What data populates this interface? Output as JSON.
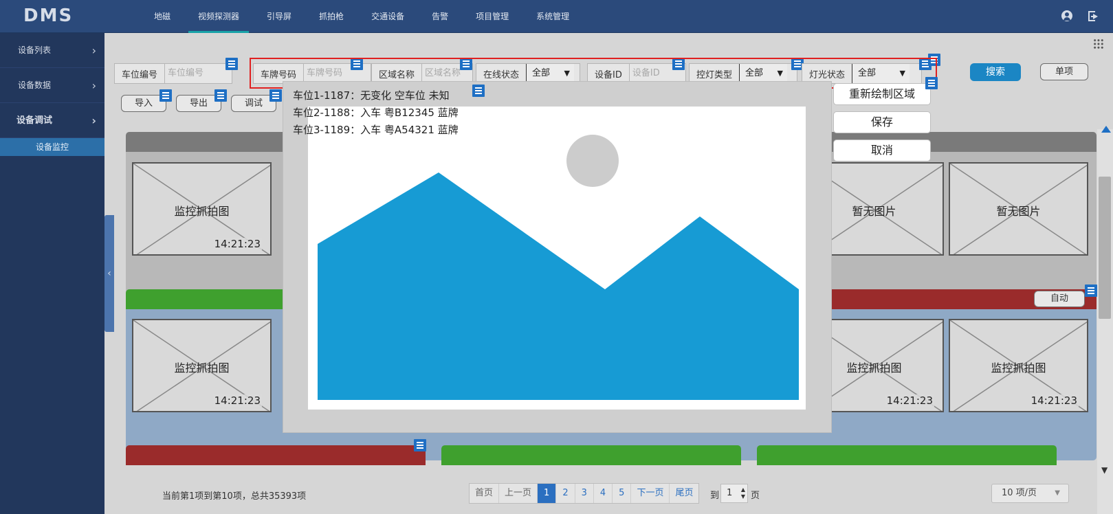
{
  "app": {
    "logo": "DMS",
    "nav": [
      "地磁",
      "视频探测器",
      "引导屏",
      "抓拍枪",
      "交通设备",
      "告警",
      "项目管理",
      "系统管理"
    ],
    "active_nav": "视频探测器"
  },
  "sidebar": {
    "items": [
      {
        "label": "设备列表",
        "chevron": "›"
      },
      {
        "label": "设备数据",
        "chevron": "›"
      },
      {
        "label": "设备调试",
        "chevron": "›"
      }
    ],
    "sub_item": "设备监控",
    "collapse_glyph": "‹"
  },
  "filters": {
    "space_no_label": "车位编号",
    "space_no_placeholder": "车位编号",
    "plate_label": "车牌号码",
    "plate_placeholder": "车牌号码",
    "area_label": "区域名称",
    "area_placeholder": "区域名称",
    "online_label": "在线状态",
    "online_value": "全部",
    "device_id_label": "设备ID",
    "device_id_placeholder": "设备ID",
    "light_type_label": "控灯类型",
    "light_type_value": "全部",
    "light_status_label": "灯光状态",
    "light_status_value": "全部",
    "search_button": "搜索",
    "single_button": "单项"
  },
  "toolbar": {
    "import": "导入",
    "export": "导出",
    "debug": "调试"
  },
  "cards": {
    "row1": [
      {
        "label": "监控抓拍图",
        "time": "14:21:23"
      },
      {
        "label": "暂无图片",
        "time": ""
      },
      {
        "label": "暂无图片",
        "time": ""
      }
    ],
    "row2": [
      {
        "label": "监控抓拍图",
        "time": "14:21:23"
      },
      {
        "label": "监控抓拍图",
        "time": "14:21:23"
      },
      {
        "label": "监控抓拍图",
        "time": "14:21:23"
      }
    ],
    "auto_button": "自动",
    "colors": {
      "gray": "#7a7a7a",
      "green": "#3fa02e",
      "red": "#9a2b2b"
    }
  },
  "footer": {
    "info": "当前第1项到第10项，总共35393项",
    "pager": {
      "first": "首页",
      "prev": "上一页",
      "pages": [
        "1",
        "2",
        "3",
        "4",
        "5"
      ],
      "active_page": "1",
      "next": "下一页",
      "last": "尾页"
    },
    "goto_prefix": "到",
    "goto_value": "1",
    "goto_suffix": "页",
    "page_size": "10 项/页"
  },
  "modal": {
    "lines": [
      "车位1-1187：无变化 空车位 未知",
      "车位2-1188：入车 粤B12345 蓝牌",
      "车位3-1189：入车 粤A54321 蓝牌"
    ],
    "image_colors": {
      "mountain": "#179bd4",
      "sun": "#cccccc"
    },
    "buttons": {
      "redraw": "重新绘制区域",
      "save": "保存",
      "cancel": "取消"
    }
  }
}
